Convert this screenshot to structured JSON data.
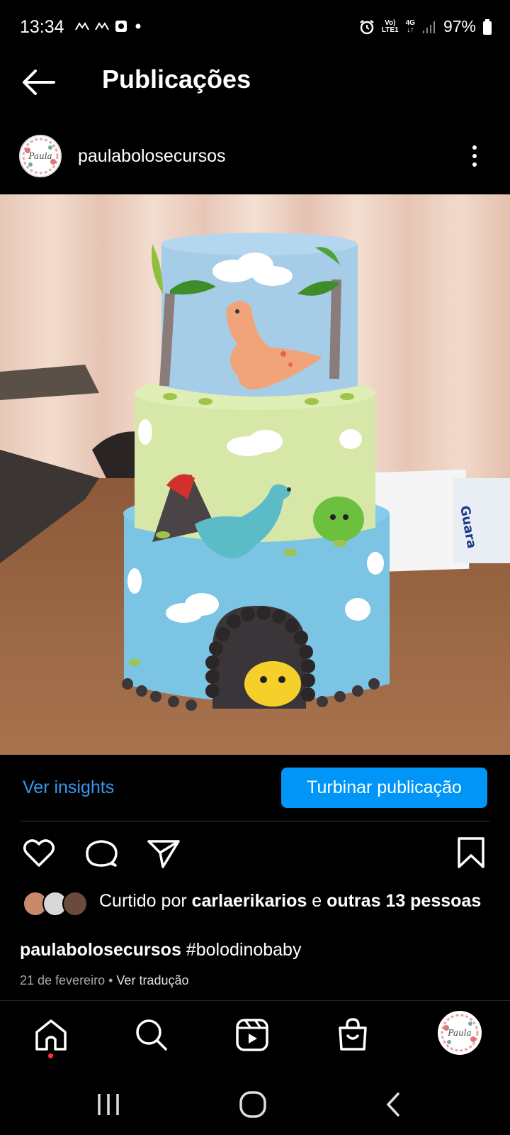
{
  "status_bar": {
    "time": "13:34",
    "network_top": "Vo)",
    "network_bottom": "LTE1",
    "gen": "4G",
    "battery": "97%"
  },
  "header": {
    "title": "Publicações",
    "back_icon": "arrow-left-icon"
  },
  "post": {
    "username": "paulabolosecursos",
    "avatar_logo_text": "Paula",
    "image_description_icon": "post-photo",
    "insights_label": "Ver insights",
    "boost_label": "Turbinar publicação",
    "likes": {
      "prefix": "Curtido por",
      "user": "carlaerikarios",
      "joiner": "e",
      "others": "outras 13 pessoas"
    },
    "caption_user": "paulabolosecursos",
    "caption_text": "#bolodinobaby",
    "date": "21 de fevereiro",
    "separator": "•",
    "translate_label": "Ver tradução"
  },
  "bottom_nav": {
    "items": [
      "home-icon",
      "search-icon",
      "reels-icon",
      "shop-icon",
      "profile-avatar"
    ]
  },
  "colors": {
    "background": "#000000",
    "link_blue": "#3897f0",
    "button_blue": "#0095f6",
    "notification_red": "#ff3040"
  }
}
